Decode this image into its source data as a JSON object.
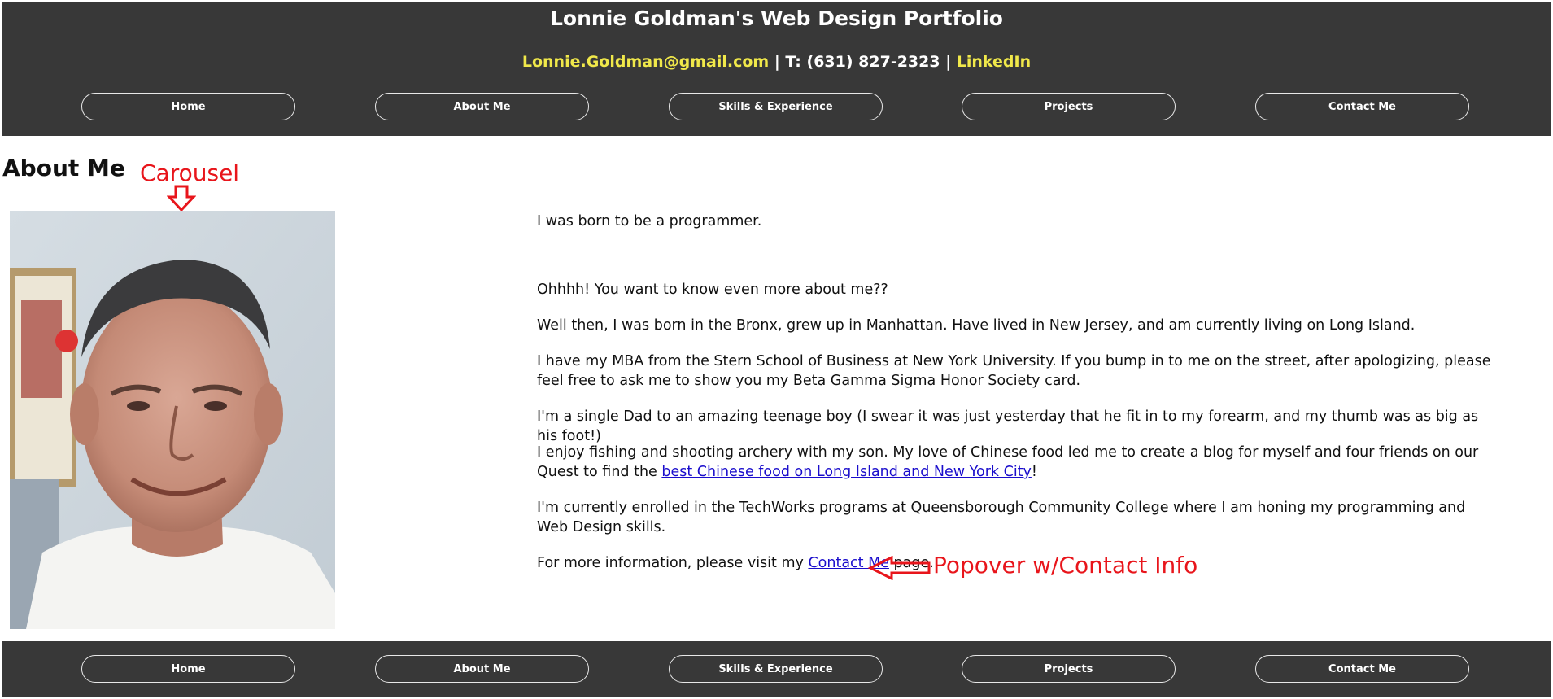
{
  "header": {
    "title": "Lonnie Goldman's Web Design Portfolio",
    "email": "Lonnie.Goldman@gmail.com",
    "separator": " | ",
    "phone": "T: (631) 827-2323",
    "linkedin": "LinkedIn"
  },
  "nav": {
    "items": [
      {
        "label": "Home"
      },
      {
        "label": "About Me"
      },
      {
        "label": "Skills & Experience"
      },
      {
        "label": "Projects"
      },
      {
        "label": "Contact Me"
      }
    ]
  },
  "footer_nav": {
    "items": [
      {
        "label": "Home"
      },
      {
        "label": "About Me"
      },
      {
        "label": "Skills & Experience"
      },
      {
        "label": "Projects"
      },
      {
        "label": "Contact Me"
      }
    ]
  },
  "main": {
    "heading": "About Me",
    "paragraphs": [
      {
        "text": "I was born to be a programmer."
      },
      {
        "text": "Ohhhh! You want to know even more about me??"
      },
      {
        "text": "Well then, I was born in the Bronx, grew up in Manhattan. Have lived in New Jersey, and am currently living on Long Island."
      },
      {
        "text": "I have my MBA from the Stern School of Business at New York University. If you bump in to me on the street, after apologizing, please feel free to ask me to show you my Beta Gamma Sigma Honor Society card."
      },
      {
        "text": "I'm a single Dad to an amazing teenage boy (I swear it was just yesterday that he fit in to my forearm, and my thumb was as big as his foot!)"
      },
      {
        "text_before": "I enjoy fishing and shooting archery with my son. My love of Chinese food led me to create a blog for myself and four friends on our Quest to find the ",
        "link": "best Chinese food on Long Island and New York City",
        "text_after": "!"
      },
      {
        "text": "I'm currently enrolled in the TechWorks programs at Queensborough Community College where I am honing my programming and Web Design skills."
      },
      {
        "text_before": "For more information, please visit my ",
        "link": "Contact Me",
        "text_after": " page."
      }
    ]
  },
  "annotations": {
    "carousel": "Carousel",
    "popover": "Popover w/Contact Info"
  },
  "colors": {
    "header_bg": "#383838",
    "link_yellow": "#f0e84a",
    "annotation_red": "#e8151b",
    "link_blue": "#1a0dcc"
  }
}
